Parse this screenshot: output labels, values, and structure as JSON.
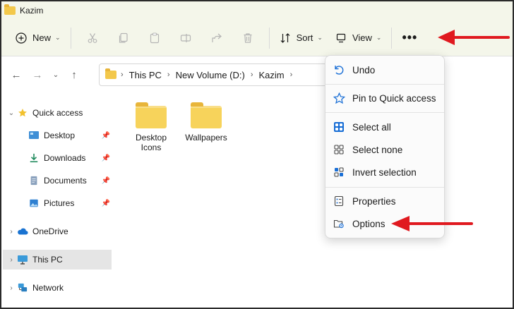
{
  "window": {
    "title": "Kazim"
  },
  "toolbar": {
    "new_label": "New",
    "sort_label": "Sort",
    "view_label": "View",
    "more_label": "•••",
    "icons": [
      "cut-icon",
      "copy-icon",
      "paste-icon",
      "rename-icon",
      "share-icon",
      "delete-icon"
    ]
  },
  "address": {
    "crumbs": [
      "This PC",
      "New Volume (D:)",
      "Kazim"
    ]
  },
  "sidebar": {
    "items": [
      {
        "label": "Quick access",
        "icon": "star-icon"
      },
      {
        "label": "Desktop",
        "icon": "desktop-icon",
        "pinned": true
      },
      {
        "label": "Downloads",
        "icon": "download-icon",
        "pinned": true
      },
      {
        "label": "Documents",
        "icon": "documents-icon",
        "pinned": true
      },
      {
        "label": "Pictures",
        "icon": "pictures-icon",
        "pinned": true
      },
      {
        "label": "OneDrive",
        "icon": "cloud-icon"
      },
      {
        "label": "This PC",
        "icon": "monitor-icon",
        "selected": true
      },
      {
        "label": "Network",
        "icon": "network-icon"
      }
    ]
  },
  "files": [
    {
      "name_line1": "Desktop",
      "name_line2": "Icons"
    },
    {
      "name_line1": "Wallpapers",
      "name_line2": ""
    }
  ],
  "menu": {
    "items": [
      {
        "label": "Undo",
        "icon": "undo-icon"
      },
      {
        "label": "Pin to Quick access",
        "icon": "pin-star-icon"
      },
      {
        "label": "Select all",
        "icon": "select-all-icon"
      },
      {
        "label": "Select none",
        "icon": "select-none-icon"
      },
      {
        "label": "Invert selection",
        "icon": "invert-selection-icon"
      },
      {
        "label": "Properties",
        "icon": "properties-icon"
      },
      {
        "label": "Options",
        "icon": "options-icon"
      }
    ]
  },
  "colors": {
    "accent": "#1a6fd6",
    "arrow": "#e0191f",
    "folder": "#f7d35b",
    "toolbar_bg": "#f4f6ea"
  }
}
